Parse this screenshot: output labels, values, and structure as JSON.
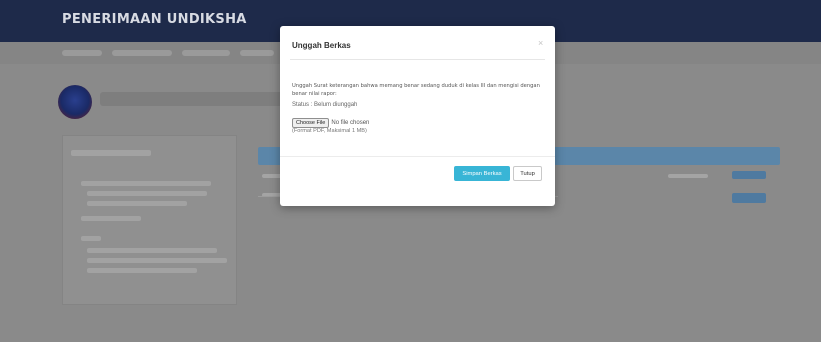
{
  "header": {
    "brand": "PENERIMAAN UNDIKSHA"
  },
  "modal": {
    "title": "Unggah Berkas",
    "close_glyph": "×",
    "description": "Unggah Surat keterangan bahwa memang benar sedang duduk di kelas III dan mengisi dengan benar nilai rapor:",
    "status": "Status : Belum diunggah",
    "file_button": "Choose File",
    "file_status": "No file chosen",
    "file_hint": "(Format PDF, Maksimal 1 MB)",
    "save_button": "Simpan Berkas",
    "close_button": "Tutup"
  },
  "colors": {
    "navbar": "#1e2a4a",
    "primary_button": "#38b5d6",
    "overlay": "#8a8a8a"
  },
  "icons": {
    "close": "close-icon"
  }
}
